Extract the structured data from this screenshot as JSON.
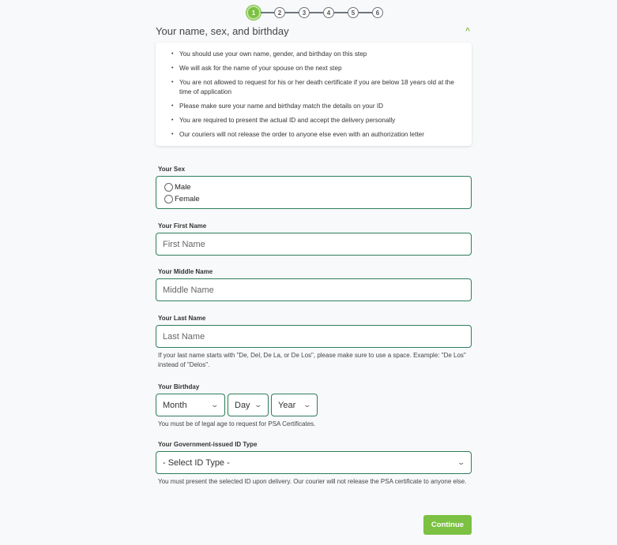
{
  "stepper": {
    "steps": [
      "1",
      "2",
      "3",
      "4",
      "5",
      "6"
    ],
    "active_step": 1,
    "accent_color": "#7cc142"
  },
  "section": {
    "title": "Your name, sex, and birthday",
    "collapse_icon": "chevron-up-icon"
  },
  "info": {
    "items": [
      "You should use your own name, gender, and birthday on this step",
      "We will ask for the name of your spouse on the next step",
      "You are not allowed to request for his or her death certificate if you are below 18 years old at the time of application",
      "Please make sure your name and birthday match the details on your ID",
      "You are required to present the actual ID and accept the delivery personally",
      "Our couriers will not release the order to anyone else even with an authorization letter"
    ]
  },
  "form": {
    "sex": {
      "label": "Your Sex",
      "options": [
        "Male",
        "Female"
      ]
    },
    "first_name": {
      "label": "Your First Name",
      "placeholder": "First Name",
      "value": ""
    },
    "middle_name": {
      "label": "Your Middle Name",
      "placeholder": "Middle Name",
      "value": ""
    },
    "last_name": {
      "label": "Your Last Name",
      "placeholder": "Last Name",
      "value": "",
      "hint": "If your last name starts with \"De, Del, De La, or De Los\", please make sure to use a space. Example: \"De Los\" instead of \"Delos\"."
    },
    "birthday": {
      "label": "Your Birthday",
      "month": "Month",
      "day": "Day",
      "year": "Year",
      "hint": "You must be of legal age to request for PSA Certificates."
    },
    "id_type": {
      "label": "Your Government-issued ID Type",
      "selected": "- Select ID Type -",
      "hint": "You must present the selected ID upon delivery. Our courier will not release the PSA certificate to anyone else."
    }
  },
  "actions": {
    "continue_label": "Continue"
  }
}
